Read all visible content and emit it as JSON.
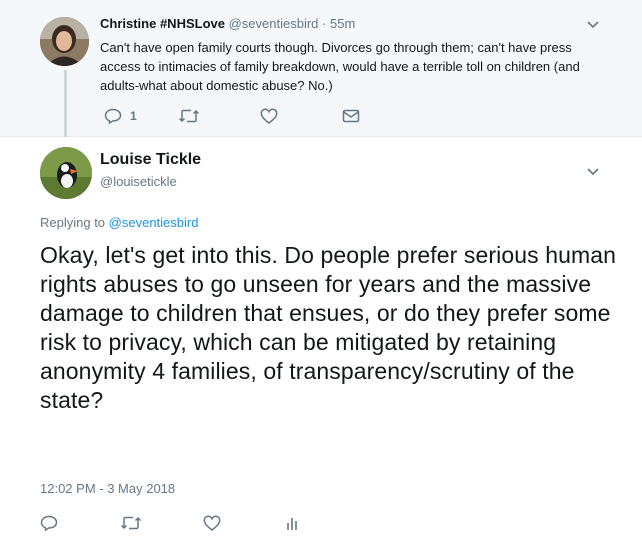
{
  "reply": {
    "name": "Christine #NHSLove",
    "handle": "@seventiesbird",
    "separator": "·",
    "time": "55m",
    "text": "Can't have open family courts though. Divorces go through them; can't have press access to intimacies of family breakdown, would have a terrible toll on children (and adults-what about domestic abuse? No.)",
    "actions": {
      "reply_count": "1"
    }
  },
  "tweet": {
    "name": "Louise Tickle",
    "handle": "@louisetickle",
    "replying_prefix": "Replying to",
    "replying_to": "@seventiesbird",
    "text": "Okay, let's get into this. Do people prefer serious human rights abuses to go unseen for years and the massive damage to children that ensues, or do they prefer some risk to privacy, which can be mitigated by retaining anonymity 4 families, of transparency/scrutiny of the state?",
    "timestamp": "12:02 PM - 3 May 2018"
  },
  "icons": {
    "reply": "reply-icon",
    "retweet": "retweet-icon",
    "like": "heart-icon",
    "dm": "envelope-icon",
    "analytics": "analytics-icon",
    "more": "chevron-down-icon"
  },
  "colors": {
    "text": "#14171a",
    "secondary": "#657786",
    "link": "#1b95e0",
    "reply_bg": "#f5f8fa",
    "thread_line": "#ccd6dd"
  }
}
